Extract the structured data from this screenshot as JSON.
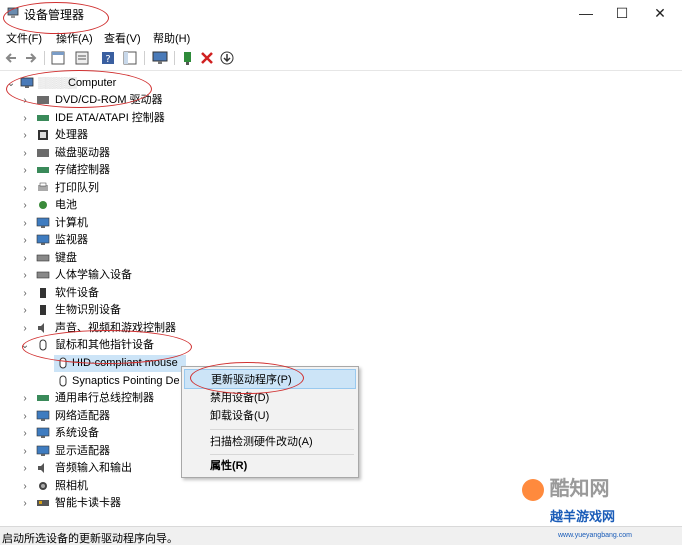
{
  "window": {
    "title": "设备管理器"
  },
  "menu": [
    "文件(F)",
    "操作(A)",
    "查看(V)",
    "帮助(H)"
  ],
  "toolbar_icons": [
    "back-icon",
    "forward-icon",
    "properties-icon",
    "show-hidden-icon",
    "help-icon",
    "console-tree-icon",
    "monitor-icon",
    "update-driver-icon",
    "uninstall-icon",
    "download-icon"
  ],
  "tree": {
    "root": "Computer",
    "categories": [
      {
        "label": "DVD/CD-ROM 驱动器",
        "icon": "dvd-drive-icon"
      },
      {
        "label": "IDE ATA/ATAPI 控制器",
        "icon": "ide-controller-icon"
      },
      {
        "label": "处理器",
        "icon": "processor-icon"
      },
      {
        "label": "磁盘驱动器",
        "icon": "disk-drive-icon"
      },
      {
        "label": "存储控制器",
        "icon": "storage-controller-icon"
      },
      {
        "label": "打印队列",
        "icon": "printer-icon"
      },
      {
        "label": "电池",
        "icon": "battery-icon"
      },
      {
        "label": "计算机",
        "icon": "computer-icon"
      },
      {
        "label": "监视器",
        "icon": "monitor-icon"
      },
      {
        "label": "键盘",
        "icon": "keyboard-icon"
      },
      {
        "label": "人体学输入设备",
        "icon": "hid-icon"
      },
      {
        "label": "软件设备",
        "icon": "software-device-icon"
      },
      {
        "label": "生物识别设备",
        "icon": "biometric-icon"
      },
      {
        "label": "声音、视频和游戏控制器",
        "icon": "sound-icon"
      },
      {
        "label": "鼠标和其他指针设备",
        "icon": "mouse-icon",
        "expanded": true
      }
    ],
    "mouse_children": [
      "HID-compliant mouse",
      "Synaptics Pointing De"
    ],
    "categories_after": [
      {
        "label": "通用串行总线控制器",
        "icon": "usb-icon"
      },
      {
        "label": "网络适配器",
        "icon": "network-icon"
      },
      {
        "label": "系统设备",
        "icon": "system-device-icon"
      },
      {
        "label": "显示适配器",
        "icon": "display-adapter-icon"
      },
      {
        "label": "音频输入和输出",
        "icon": "audio-icon"
      },
      {
        "label": "照相机",
        "icon": "camera-icon"
      },
      {
        "label": "智能卡读卡器",
        "icon": "smart-card-icon"
      }
    ]
  },
  "context_menu": {
    "items": [
      "更新驱动程序(P)",
      "禁用设备(D)",
      "卸载设备(U)",
      "扫描检测硬件改动(A)",
      "属性(R)"
    ]
  },
  "status": "启动所选设备的更新驱动程序向导。",
  "watermarks": {
    "kuzhiwang": "酷知网",
    "yueyang": "越羊游戏网",
    "yueyang_url": "www.yueyangbang.com"
  }
}
